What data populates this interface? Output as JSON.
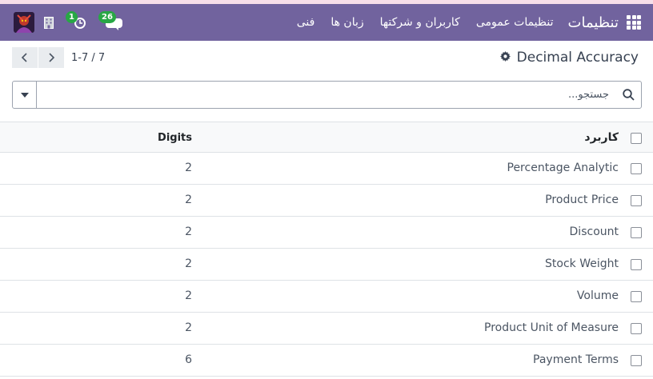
{
  "navbar": {
    "app_title": "تنظیمات",
    "menu_items": [
      "تنظیمات عمومی",
      "کاربران و شرکتها",
      "زبان ها",
      "فنی"
    ],
    "messages_count": "26",
    "activities_count": "1"
  },
  "control_panel": {
    "breadcrumb": "Decimal Accuracy",
    "pager": "1-7 / 7"
  },
  "search": {
    "placeholder": "جستجو..."
  },
  "table": {
    "columns": {
      "name": "کاربرد",
      "digits": "Digits"
    },
    "rows": [
      {
        "name": "Percentage Analytic",
        "digits": "2"
      },
      {
        "name": "Product Price",
        "digits": "2"
      },
      {
        "name": "Discount",
        "digits": "2"
      },
      {
        "name": "Stock Weight",
        "digits": "2"
      },
      {
        "name": "Volume",
        "digits": "2"
      },
      {
        "name": "Product Unit of Measure",
        "digits": "2"
      },
      {
        "name": "Payment Terms",
        "digits": "6"
      }
    ]
  },
  "colors": {
    "navbar": "#71639e",
    "badge": "#28a745"
  }
}
